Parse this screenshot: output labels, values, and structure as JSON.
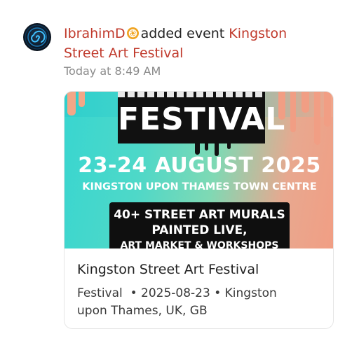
{
  "post": {
    "username": "IbrahimD",
    "action": "added event",
    "event_name_line1": "Kingston",
    "event_name_line2": "Street Art Festival",
    "timestamp": "Today at 8:49 AM",
    "avatar_icon": "spiral-avatar-icon",
    "badge_icon": "aperture-badge-icon"
  },
  "poster": {
    "headline": "FESTIVAL",
    "dates": "23-24 AUGUST 2025",
    "location": "KINGSTON UPON THAMES TOWN CENTRE",
    "info_line1": "40+ STREET ART MURALS",
    "info_line2": "PAINTED LIVE,",
    "info_line3": "ART MARKET & WORKSHOPS"
  },
  "card": {
    "title": "Kingston Street Art Festival",
    "category": "Festival",
    "date": "2025-08-23",
    "location_line1": "Kingston",
    "location_line2": "upon Thames, UK, GB"
  },
  "colors": {
    "link_red": "#c0392b",
    "timestamp_gray": "#8a8a8a",
    "badge_orange": "#f0a422",
    "poster_teal": "#38d6d0",
    "poster_peach": "#f19e84"
  }
}
